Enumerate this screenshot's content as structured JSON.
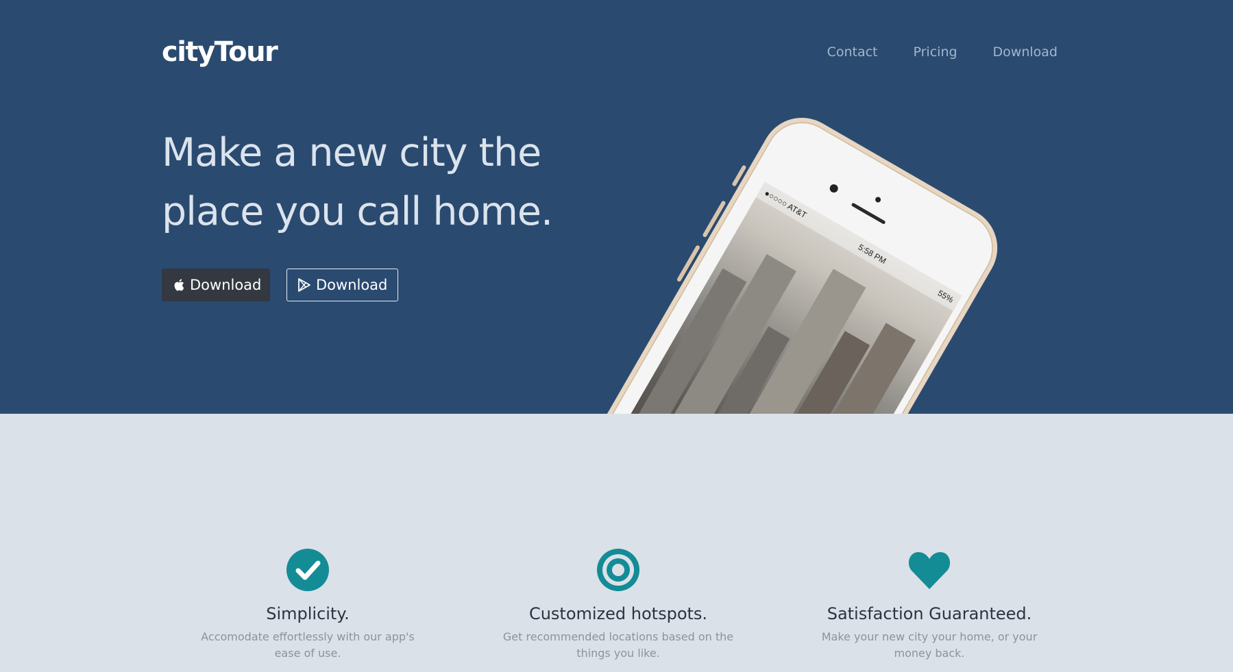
{
  "brand": "cityTour",
  "nav": {
    "links": [
      "Contact",
      "Pricing",
      "Download"
    ]
  },
  "hero": {
    "headline_line1": "Make a new city the",
    "headline_line2": "place you call home.",
    "apple_button": "Download",
    "play_button": "Download"
  },
  "phone": {
    "carrier": "●○○○○ AT&T",
    "time": "5:58 PM",
    "battery": "55%"
  },
  "features": [
    {
      "icon": "check-circle-icon",
      "title": "Simplicity.",
      "text": "Accomodate effortlessly with our app's ease of use."
    },
    {
      "icon": "target-icon",
      "title": "Customized hotspots.",
      "text": "Get recommended locations based on the things you like."
    },
    {
      "icon": "heart-icon",
      "title": "Satisfaction Guaranteed.",
      "text": "Make your new city your home, or your money back."
    }
  ],
  "colors": {
    "hero_bg": "#2a4a70",
    "features_bg": "#dbe1e8",
    "accent": "#138c96",
    "dark_button": "#333841"
  }
}
